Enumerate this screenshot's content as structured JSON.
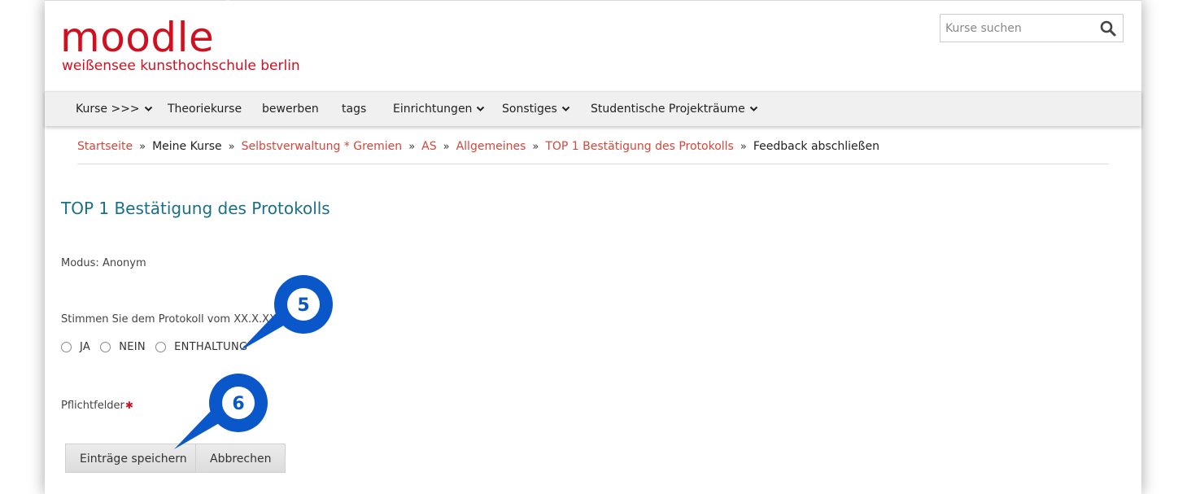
{
  "header": {
    "logo_word": "moodle",
    "logo_sub": "weißensee kunsthochschule berlin",
    "search_placeholder": "Kurse suchen"
  },
  "nav": {
    "items": [
      {
        "label": "Kurse >>>",
        "dropdown": true
      },
      {
        "label": "Theoriekurse",
        "dropdown": false
      },
      {
        "label": "bewerben",
        "dropdown": false
      },
      {
        "label": "tags",
        "dropdown": false
      },
      {
        "label": "Einrichtungen",
        "dropdown": true
      },
      {
        "label": "Sonstiges",
        "dropdown": true
      },
      {
        "label": "Studentische Projekträume",
        "dropdown": true
      }
    ]
  },
  "breadcrumb": [
    {
      "label": "Startseite",
      "link": true
    },
    {
      "label": "Meine Kurse",
      "link": false
    },
    {
      "label": "Selbstverwaltung * Gremien",
      "link": true
    },
    {
      "label": "AS",
      "link": true
    },
    {
      "label": "Allgemeines",
      "link": true
    },
    {
      "label": "TOP 1 Bestätigung des Protokolls",
      "link": true
    },
    {
      "label": "Feedback abschließen",
      "link": false
    }
  ],
  "main": {
    "title": "TOP 1 Bestätigung des Protokolls",
    "modus": "Modus: Anonym",
    "question": "Stimmen Sie dem Protokoll vom XX.X.XX zu?",
    "options": [
      "JA",
      "NEIN",
      "ENTHALTUNG"
    ],
    "required_label": "Pflichtfelder",
    "save_label": "Einträge speichern",
    "cancel_label": "Abbrechen"
  },
  "annotations": {
    "callout_5": "5",
    "callout_6": "6"
  },
  "colors": {
    "brand_red": "#d1101f",
    "link_red": "#d2473c",
    "title_teal": "#1a6f8a",
    "callout_blue": "#0a57c9"
  }
}
